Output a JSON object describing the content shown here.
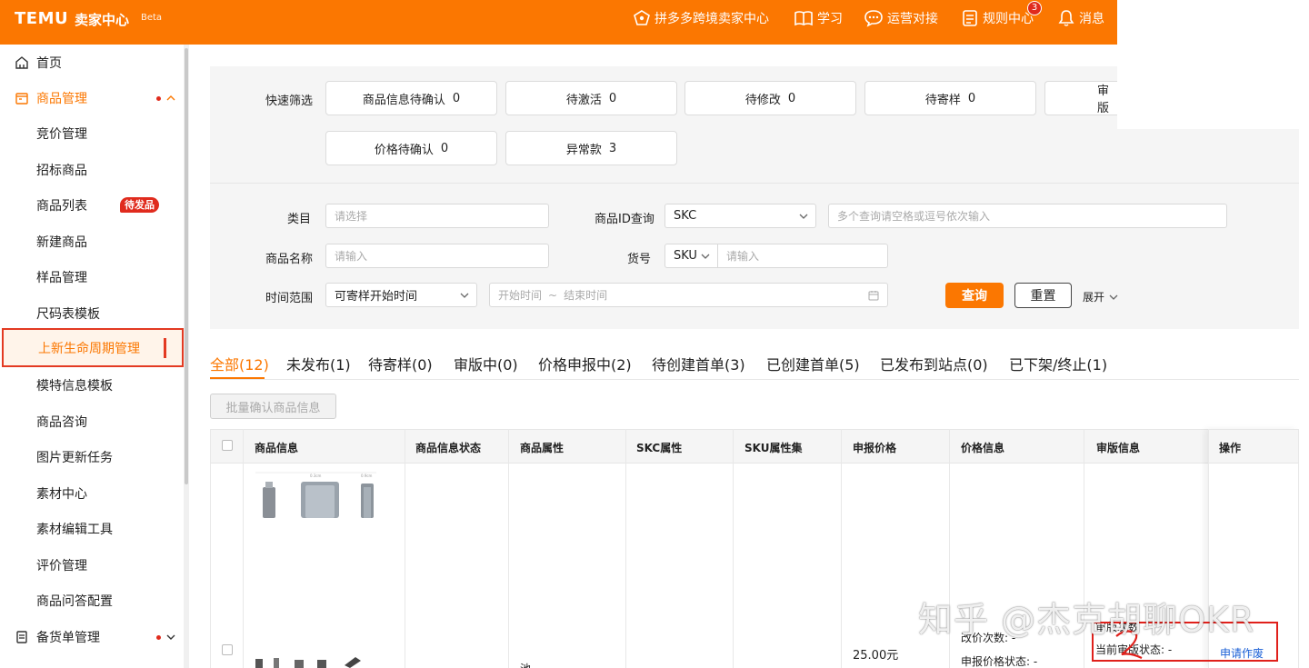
{
  "header": {
    "logo": "TEMU",
    "logo_sub": "卖家中心",
    "beta": "Beta",
    "nav": [
      {
        "label": "拼多多跨境卖家中心",
        "icon": "pdd-logo-icon"
      },
      {
        "label": "学习",
        "icon": "book-icon"
      },
      {
        "label": "运营对接",
        "icon": "chat-icon"
      },
      {
        "label": "规则中心",
        "icon": "document-icon",
        "badge": "3"
      },
      {
        "label": "消息",
        "icon": "bell-icon"
      }
    ]
  },
  "sidebar": {
    "items": [
      {
        "label": "首页",
        "type": "top",
        "icon": "home-icon"
      },
      {
        "label": "商品管理",
        "type": "top",
        "icon": "goods-icon",
        "expanded": true
      },
      {
        "label": "竞价管理",
        "type": "sub"
      },
      {
        "label": "招标商品",
        "type": "sub"
      },
      {
        "label": "商品列表",
        "type": "sub",
        "tag": "待发品"
      },
      {
        "label": "新建商品",
        "type": "sub"
      },
      {
        "label": "样品管理",
        "type": "sub"
      },
      {
        "label": "尺码表模板",
        "type": "sub"
      },
      {
        "label": "上新生命周期管理",
        "type": "sub",
        "active": true
      },
      {
        "label": "模特信息模板",
        "type": "sub"
      },
      {
        "label": "商品咨询",
        "type": "sub"
      },
      {
        "label": "图片更新任务",
        "type": "sub"
      },
      {
        "label": "素材中心",
        "type": "sub"
      },
      {
        "label": "素材编辑工具",
        "type": "sub"
      },
      {
        "label": "评价管理",
        "type": "sub"
      },
      {
        "label": "商品问答配置",
        "type": "sub"
      },
      {
        "label": "备货单管理",
        "type": "top",
        "icon": "order-icon"
      }
    ]
  },
  "quick_filter": {
    "label": "快速筛选",
    "buttons": [
      {
        "label": "商品信息待确认",
        "count": "0"
      },
      {
        "label": "待激活",
        "count": "0"
      },
      {
        "label": "待修改",
        "count": "0"
      },
      {
        "label": "待寄样",
        "count": "0"
      },
      {
        "label": "审版",
        "count": ""
      },
      {
        "label": "价格待确认",
        "count": "0"
      },
      {
        "label": "异常款",
        "count": "3"
      }
    ]
  },
  "search_form": {
    "category_label": "类目",
    "category_placeholder": "请选择",
    "product_id_label": "商品ID查询",
    "product_id_type": "SKC",
    "product_id_placeholder": "多个查询请空格或逗号依次输入",
    "name_label": "商品名称",
    "name_placeholder": "请输入",
    "item_no_label": "货号",
    "item_no_type": "SKU",
    "item_no_placeholder": "请输入",
    "time_label": "时间范围",
    "time_type": "可寄样开始时间",
    "time_start_placeholder": "开始时间",
    "time_sep": "~",
    "time_end_placeholder": "结束时间",
    "query_button": "查询",
    "reset_button": "重置",
    "expand": "展开"
  },
  "tabs": [
    {
      "label": "全部(12)",
      "active": true
    },
    {
      "label": "未发布(1)"
    },
    {
      "label": "待寄样(0)"
    },
    {
      "label": "审版中(0)"
    },
    {
      "label": "价格申报中(2)"
    },
    {
      "label": "待创建首单(3)"
    },
    {
      "label": "已创建首单(5)"
    },
    {
      "label": "已发布到站点(0)"
    },
    {
      "label": "已下架/终止(1)"
    }
  ],
  "batch_button": "批量确认商品信息",
  "table": {
    "columns": [
      "商品信息",
      "商品信息状态",
      "商品属性",
      "SKC属性",
      "SKU属性集",
      "申报价格",
      "价格信息",
      "审版信息",
      "操作"
    ],
    "row2": {
      "price": "25.00元",
      "price_change_count": "改价次数: -",
      "price_report_status": "申报价格状态: -",
      "review_count": "审版次数",
      "review_status": "当前审版状态: -",
      "action": "申请作废",
      "attr_fragment": "池"
    }
  },
  "watermark": "知乎 @杰克胡聊OKR",
  "colors": {
    "brand": "#fb7701",
    "link": "#1a5fd6",
    "alert": "#e02b1d"
  }
}
